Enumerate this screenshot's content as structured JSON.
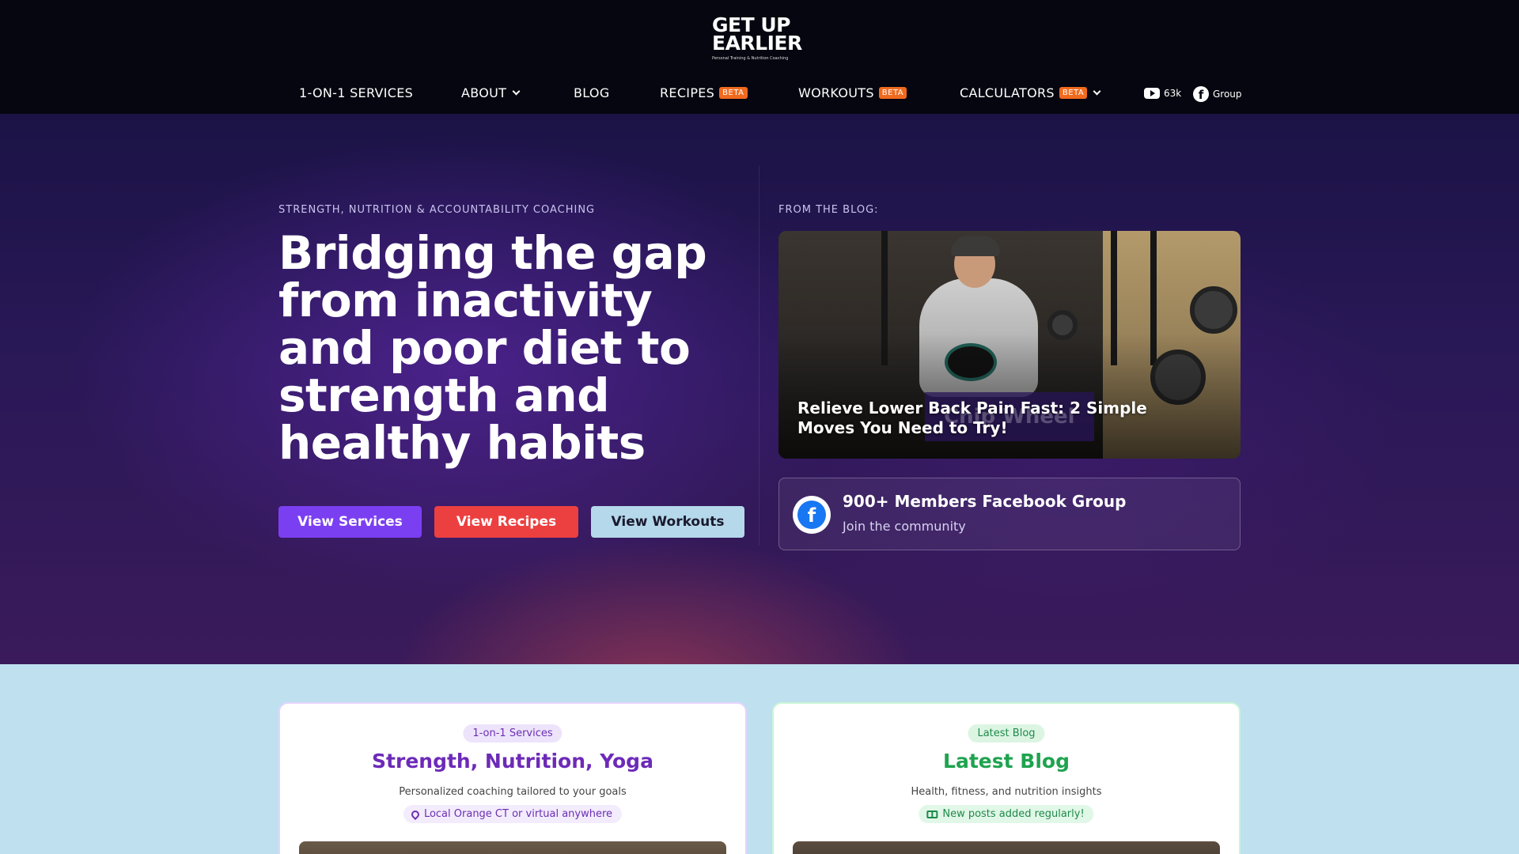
{
  "header": {
    "logo_line1": "GET UP",
    "logo_line2": "EARLIER",
    "logo_tagline": "Personal Training & Nutrition Coaching",
    "nav": {
      "services": "1-ON-1 SERVICES",
      "about": "ABOUT",
      "blog": "BLOG",
      "recipes": "RECIPES",
      "workouts": "WORKOUTS",
      "calculators": "CALCULATORS",
      "beta": "BETA"
    },
    "youtube_count": "63k",
    "facebook_label": "Group"
  },
  "hero": {
    "kicker": "STRENGTH, NUTRITION & ACCOUNTABILITY COACHING",
    "headline": "Bridging the gap from inactivity and poor diet to strength and healthy habits",
    "buttons": {
      "services": "View Services",
      "recipes": "View Recipes",
      "workouts": "View Workouts"
    },
    "colors": {
      "services": "#7b3ff2",
      "recipes": "#ec4040",
      "workouts": "#b5d8ea",
      "beta": "#f06a1e"
    }
  },
  "blog": {
    "kicker": "FROM THE BLOG:",
    "post_title": "Relieve Lower Back Pain Fast: 2 Simple Moves You Need to Try!",
    "overlay_text": "Chip Wheel"
  },
  "facebook_group": {
    "title": "900+ Members Facebook Group",
    "subtitle": "Join the community",
    "icon_letter": "f"
  },
  "cards": {
    "services": {
      "pill": "1-on-1 Services",
      "title": "Strength, Nutrition, Yoga",
      "subtitle": "Personalized coaching tailored to your goals",
      "chip": "Local Orange CT or virtual anywhere"
    },
    "blog": {
      "pill": "Latest Blog",
      "title": "Latest Blog",
      "subtitle": "Health, fitness, and nutrition insights",
      "chip": "New posts added regularly!"
    }
  }
}
